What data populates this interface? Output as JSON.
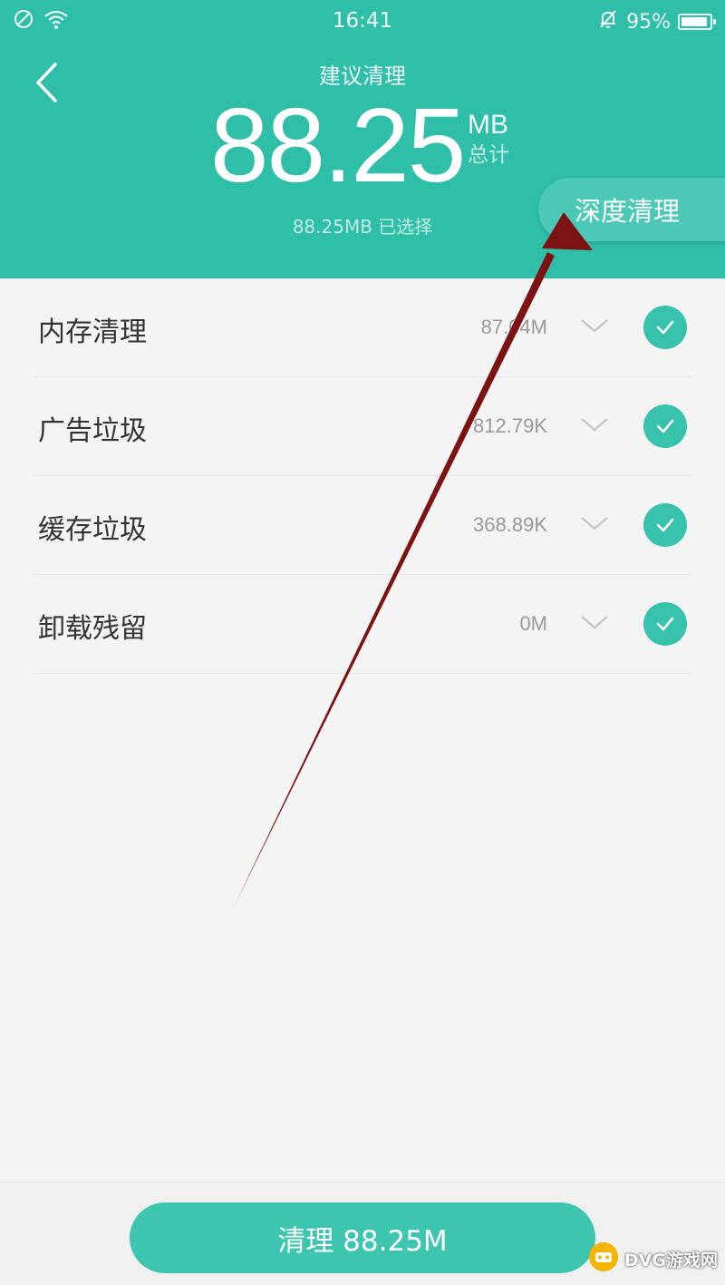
{
  "status_bar": {
    "time": "16:41",
    "battery": "95%",
    "battery_level": 0.95,
    "icons": [
      "no-sim-icon",
      "wifi-icon",
      "mute-bell-icon",
      "battery-icon"
    ]
  },
  "header": {
    "title": "建议清理",
    "total_value": "88.25",
    "total_unit": "MB",
    "total_label": "总计",
    "selected_text": "88.25MB 已选择",
    "deep_clean_label": "深度清理",
    "background_color": "#2fbfa9"
  },
  "items": [
    {
      "label": "内存清理",
      "size": "87.04M",
      "checked": true
    },
    {
      "label": "广告垃圾",
      "size": "812.79K",
      "checked": true
    },
    {
      "label": "缓存垃圾",
      "size": "368.89K",
      "checked": true
    },
    {
      "label": "卸载残留",
      "size": "0M",
      "checked": true
    }
  ],
  "bottom": {
    "clean_button_label": "清理 88.25M",
    "accent_color": "#3dc5b0"
  },
  "watermark": {
    "text": "DVG游戏网"
  }
}
